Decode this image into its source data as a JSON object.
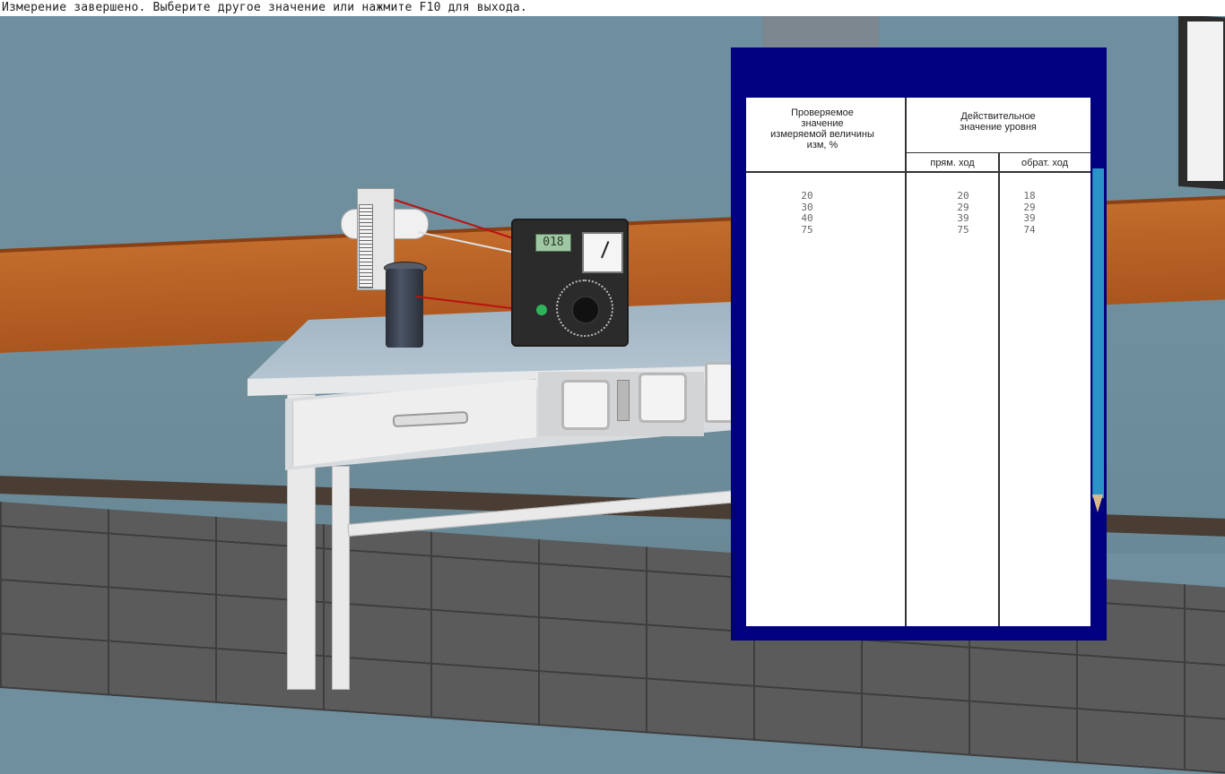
{
  "status_message": "Измерение завершено. Выберите другое значение или нажмите F10 для выхода.",
  "device": {
    "display_value": "018"
  },
  "journal": {
    "col1_header": "Проверяемое\nзначение\nизмеряемой величины\nизм, %",
    "col2_header": "Действительное\nзначение уровня",
    "sub_forward": "прям. ход",
    "sub_backward": "обрат. ход",
    "rows": [
      {
        "checked": "20",
        "forward": "20",
        "backward": "18"
      },
      {
        "checked": "30",
        "forward": "29",
        "backward": "29"
      },
      {
        "checked": "40",
        "forward": "39",
        "backward": "39"
      },
      {
        "checked": "75",
        "forward": "75",
        "backward": "74"
      }
    ]
  },
  "colors": {
    "journal_frame": "#000080",
    "stripe": "#c26c2c",
    "wall": "#6f8f9e"
  }
}
